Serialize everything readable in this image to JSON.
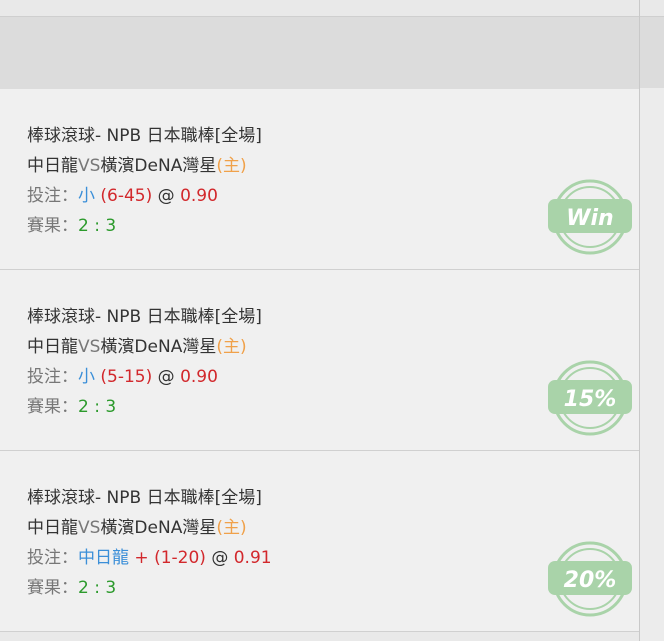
{
  "bets": [
    {
      "league": "棒球滾球- NPB 日本職棒[全場]",
      "home_team": "中日龍",
      "vs": "VS",
      "away_team": "橫濱DeNA灣星",
      "home_tag": "(主)",
      "bet_label": "投注：",
      "pick": "小",
      "plus_sign": "",
      "line": "(6-45)",
      "at": "@",
      "odds": "0.90",
      "result_label": "賽果：",
      "score": "2 : 3",
      "stamp": "Win"
    },
    {
      "league": "棒球滾球- NPB 日本職棒[全場]",
      "home_team": "中日龍",
      "vs": "VS",
      "away_team": "橫濱DeNA灣星",
      "home_tag": "(主)",
      "bet_label": "投注：",
      "pick": "小",
      "plus_sign": "",
      "line": "(5-15)",
      "at": "@",
      "odds": "0.90",
      "result_label": "賽果：",
      "score": "2 : 3",
      "stamp": "15%"
    },
    {
      "league": "棒球滾球- NPB 日本職棒[全場]",
      "home_team": "中日龍",
      "vs": "VS",
      "away_team": "橫濱DeNA灣星",
      "home_tag": "(主)",
      "bet_label": "投注：",
      "pick": "中日龍",
      "plus_sign": "+",
      "line": "(1-20)",
      "at": "@",
      "odds": "0.91",
      "result_label": "賽果：",
      "score": "2 : 3",
      "stamp": "20%"
    }
  ],
  "colors": {
    "stamp_green": "#a9d3a9",
    "pick_blue": "#3b8fd8",
    "odds_red": "#d2282c",
    "home_orange": "#f0a14a",
    "score_green": "#2c9a2c"
  }
}
